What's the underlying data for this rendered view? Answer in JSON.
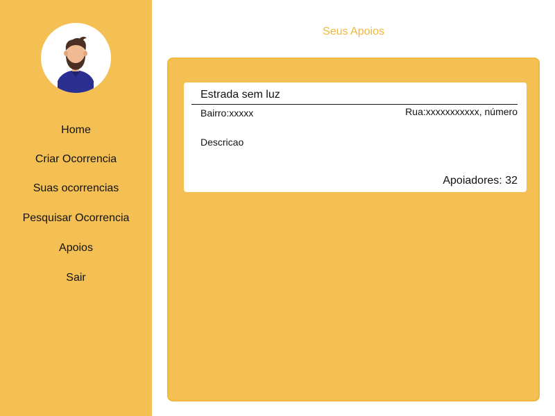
{
  "sidebar": {
    "avatar_icon": "user-avatar-icon",
    "items": [
      {
        "label": "Home"
      },
      {
        "label": "Criar Ocorrencia"
      },
      {
        "label": "Suas ocorrencias"
      },
      {
        "label": "Pesquisar Ocorrencia"
      },
      {
        "label": "Apoios"
      },
      {
        "label": "Sair"
      }
    ]
  },
  "main": {
    "title": "Seus Apoios",
    "cards": [
      {
        "title": "Estrada sem luz",
        "bairro": "Bairro:xxxxx",
        "rua": "Rua:xxxxxxxxxxx, número",
        "descricao": "Descricao",
        "apoiadores": "Apoiadores: 32"
      }
    ]
  },
  "colors": {
    "accent": "#f5c053",
    "accent_border": "#f2b63a",
    "title_text": "#f2b63a",
    "card_bg": "#ffffff",
    "text": "#111111"
  }
}
